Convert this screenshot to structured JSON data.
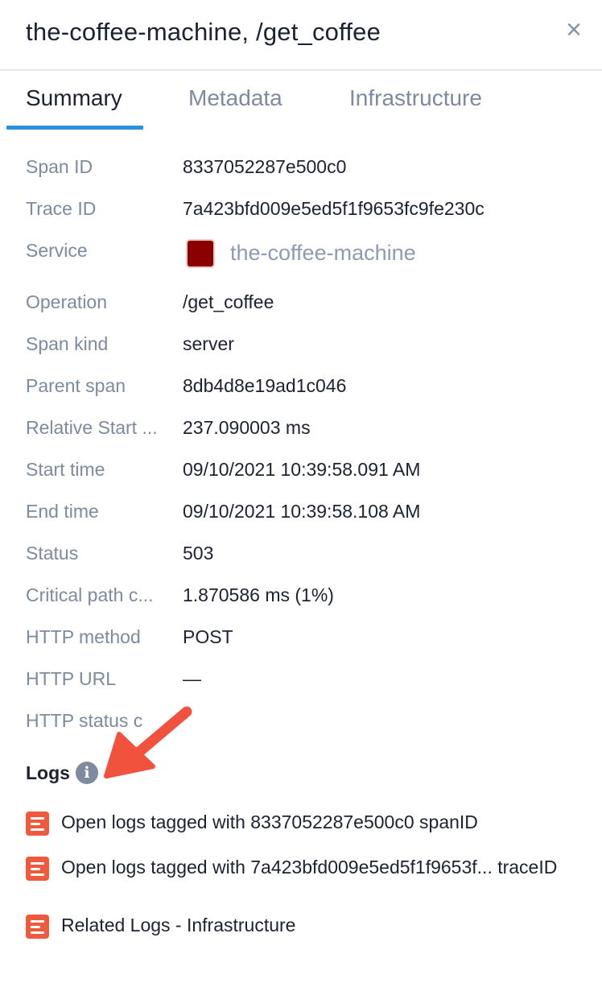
{
  "header": {
    "title": "the-coffee-machine, /get_coffee",
    "close_glyph": "×"
  },
  "tabs": [
    {
      "label": "Summary",
      "active": true
    },
    {
      "label": "Metadata",
      "active": false
    },
    {
      "label": "Infrastructure",
      "active": false
    }
  ],
  "summary": {
    "span_id": {
      "label": "Span ID",
      "value": "8337052287e500c0"
    },
    "trace_id": {
      "label": "Trace ID",
      "value": "7a423bfd009e5ed5f1f9653fc9fe230c"
    },
    "service": {
      "label": "Service",
      "value": "the-coffee-machine",
      "color": "#8b0000"
    },
    "operation": {
      "label": "Operation",
      "value": "/get_coffee"
    },
    "span_kind": {
      "label": "Span kind",
      "value": "server"
    },
    "parent_span": {
      "label": "Parent span",
      "value": "8db4d8e19ad1c046"
    },
    "relative_start": {
      "label": "Relative Start ...",
      "value": "237.090003 ms"
    },
    "start_time": {
      "label": "Start time",
      "value": "09/10/2021 10:39:58.091 AM"
    },
    "end_time": {
      "label": "End time",
      "value": "09/10/2021 10:39:58.108 AM"
    },
    "status": {
      "label": "Status",
      "value": "503"
    },
    "critical_path": {
      "label": "Critical path c...",
      "value": "1.870586 ms (1%)"
    },
    "http_method": {
      "label": "HTTP method",
      "value": "POST"
    },
    "http_url": {
      "label": "HTTP URL",
      "value": "—"
    },
    "http_status": {
      "label": "HTTP status c",
      "value": ""
    }
  },
  "logs": {
    "title": "Logs",
    "info_icon": "info-icon",
    "items": [
      {
        "label": "Open logs tagged with 8337052287e500c0 spanID",
        "icon": "log-document-icon"
      },
      {
        "label": "Open logs tagged with 7a423bfd009e5ed5f1f9653f...  traceID",
        "icon": "log-document-icon"
      },
      {
        "label": "Related Logs - Infrastructure",
        "icon": "log-document-icon"
      }
    ]
  },
  "colors": {
    "accent_tab": "#2a8fdc",
    "label_gray": "#7d8aa0",
    "log_icon": "#ef5a3c",
    "annotation_arrow": "#f0523e"
  }
}
